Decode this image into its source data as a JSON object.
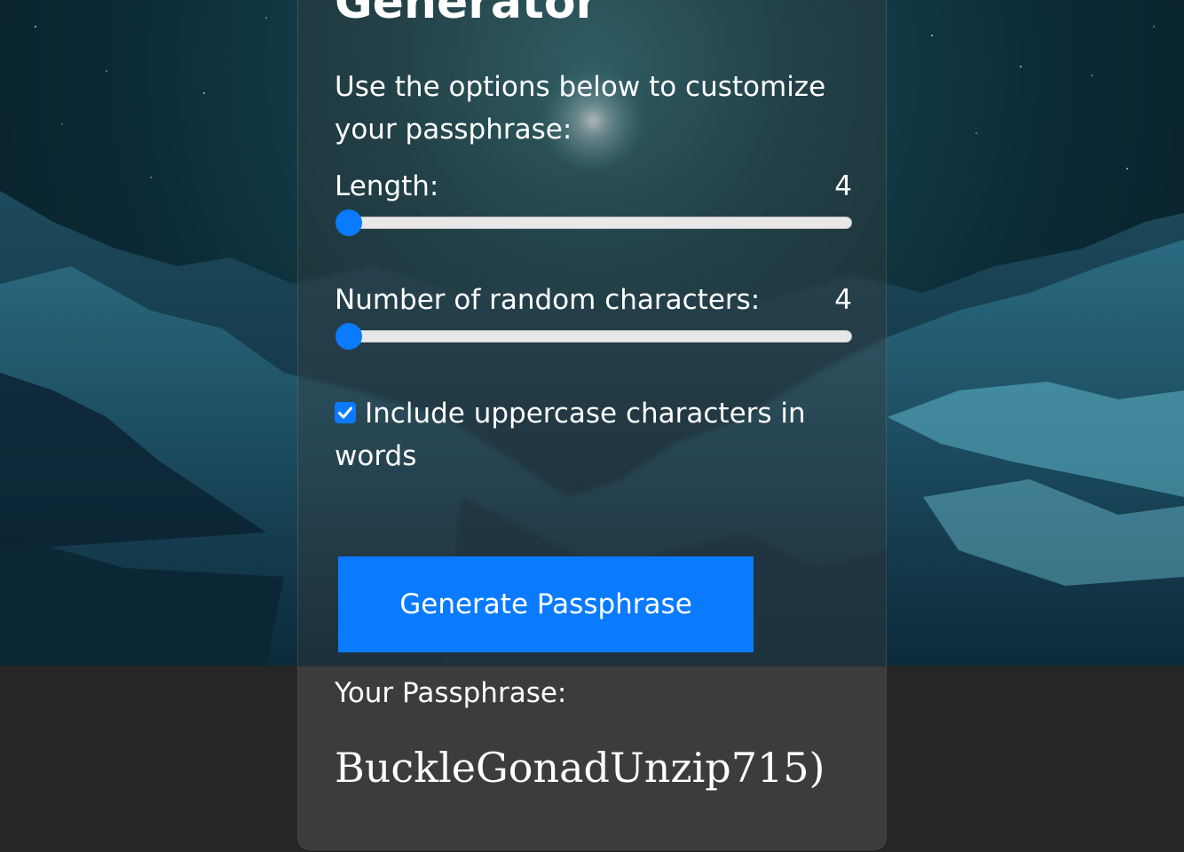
{
  "header": {
    "title": "Generator"
  },
  "intro": {
    "text": "Use the options below to customize your passphrase:"
  },
  "length": {
    "label": "Length:",
    "value": "4"
  },
  "random_chars": {
    "label": "Number of random characters:",
    "value": "4"
  },
  "uppercase": {
    "label": "Include uppercase characters in words",
    "checked": true
  },
  "actions": {
    "generate_label": "Generate Passphrase"
  },
  "result": {
    "label": "Your Passphrase:",
    "passphrase": "BuckleGonadUnzip715)"
  },
  "colors": {
    "accent": "#0a7bff",
    "page_background": "#262626",
    "card_lower": "#3c3c3c"
  },
  "icons": {
    "checkbox": "checkmark-icon"
  }
}
